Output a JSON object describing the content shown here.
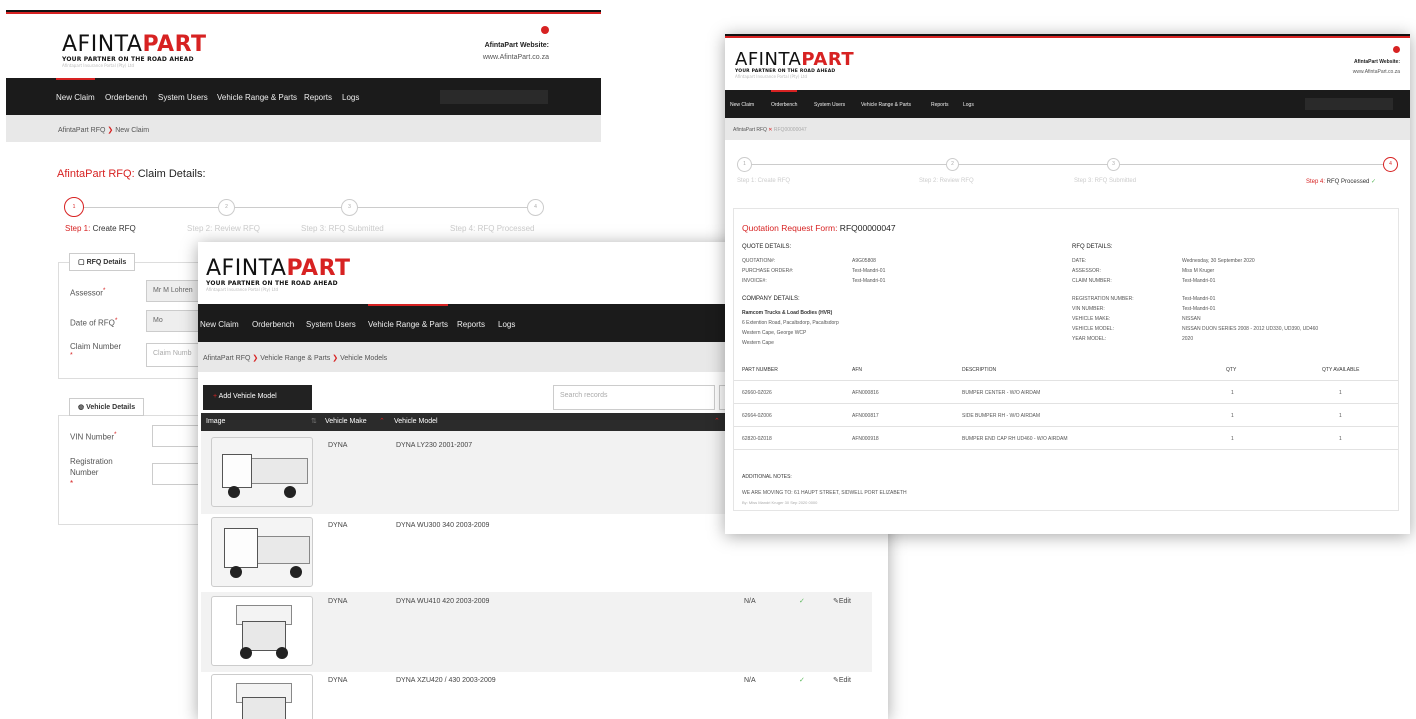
{
  "brand": {
    "part1": "AFINTA",
    "part2": "PART",
    "tagline": "YOUR PARTNER ON THE ROAD AHEAD",
    "sub": "Afintapart Insurance Portal (Pty) Ltd",
    "website_label": "AfintaPart Website:",
    "website_url": "www.AfintaPart.co.za",
    "accent": "#d72222"
  },
  "nav": {
    "items": [
      "New Claim",
      "Orderbench",
      "System Users",
      "Vehicle Range & Parts",
      "Reports",
      "Logs"
    ]
  },
  "back": {
    "breadcrumb_root": "AfintaPart RFQ",
    "breadcrumb_sep": "❯",
    "breadcrumb_current": "New Claim",
    "title_red": "AfintaPart RFQ:",
    "title_rest": " Claim Details:",
    "steps": [
      {
        "num": "1",
        "prefix": "Step 1:",
        "label": " Create RFQ"
      },
      {
        "num": "2",
        "prefix": "Step 2:",
        "label": " Review RFQ"
      },
      {
        "num": "3",
        "prefix": "Step 3:",
        "label": " RFQ Submitted"
      },
      {
        "num": "4",
        "prefix": "Step 4:",
        "label": " RFQ Processed"
      }
    ],
    "rfq_legend": "RFQ Details",
    "assessor_label": "Assessor",
    "assessor_value": "Mr M Lohren",
    "date_label": "Date of RFQ",
    "date_value": "Mo",
    "claim_label": "Claim Number",
    "claim_placeholder": "Claim Numb",
    "vehicle_legend": "Vehicle Details",
    "vin_label": "VIN Number",
    "reg_label1": "Registration",
    "reg_label2": "Number"
  },
  "vehicles": {
    "breadcrumb_root": "AfintaPart RFQ",
    "breadcrumb_mid": "Vehicle Range & Parts",
    "breadcrumb_current": "Vehicle Models",
    "breadcrumb_sep": "❯",
    "add_button": "Add Vehicle Model",
    "search_placeholder": "Search records",
    "columns": [
      "Image",
      "Vehicle Make",
      "Vehicle Model"
    ],
    "rows": [
      {
        "make": "DYNA",
        "model": "DYNA LY230 2001-2007",
        "code": "",
        "status": "",
        "edit": ""
      },
      {
        "make": "DYNA",
        "model": "DYNA WU300 340 2003-2009",
        "code": "",
        "status": "",
        "edit": ""
      },
      {
        "make": "DYNA",
        "model": "DYNA WU410 420 2003-2009",
        "code": "N/A",
        "status": "✓",
        "edit": "Edit"
      },
      {
        "make": "DYNA",
        "model": "DYNA XZU420 / 430 2003-2009",
        "code": "N/A",
        "status": "✓",
        "edit": "Edit"
      }
    ]
  },
  "quote": {
    "breadcrumb_root": "AfintaPart RFQ",
    "breadcrumb_x": "✕",
    "breadcrumb_current": "RFQ00000047",
    "steps": [
      {
        "num": "1",
        "prefix": "Step 1:",
        "label": " Create RFQ"
      },
      {
        "num": "2",
        "prefix": "Step 2:",
        "label": " Review RFQ"
      },
      {
        "num": "3",
        "prefix": "Step 3:",
        "label": " RFQ Submitted"
      },
      {
        "num": "4",
        "prefix": "Step 4:",
        "label": " RFQ Processed",
        "check": "✓"
      }
    ],
    "title_red": "Quotation Request Form:",
    "title_rest": " RFQ00000047",
    "quote_details_h": "QUOTE DETAILS:",
    "quote_details": [
      {
        "k": "QUOTATION#:",
        "v": "A9G05808"
      },
      {
        "k": "PURCHASE ORDER#:",
        "v": "Test-Mandri-01"
      },
      {
        "k": "INVOICE#:",
        "v": "Test-Mandri-01"
      }
    ],
    "rfq_details_h": "RFQ DETAILS:",
    "rfq_details": [
      {
        "k": "DATE:",
        "v": "Wednesday, 30 September 2020"
      },
      {
        "k": "ASSESSOR:",
        "v": "Miss M Kruger"
      },
      {
        "k": "CLAIM NUMBER:",
        "v": "Test-Mandri-01"
      }
    ],
    "company_h": "COMPANY DETAILS:",
    "company_lines": [
      "Ramcom Trucks & Load Bodies (HVR)",
      "6 Extention Road, Pacaltsdorp, Pacaltsdorp",
      "Western Cape, George WCP",
      "Western Cape"
    ],
    "vehicle_details": [
      {
        "k": "REGISTRATION NUMBER:",
        "v": "Test-Mandri-01"
      },
      {
        "k": "VIN NUMBER:",
        "v": "Test-Mandri-01"
      },
      {
        "k": "VEHICLE MAKE:",
        "v": "NISSAN"
      },
      {
        "k": "VEHICLE MODEL:",
        "v": "NISSAN DUON SERIES 2008 - 2012 UD330, UD390, UD460"
      },
      {
        "k": "YEAR MODEL:",
        "v": "2020"
      }
    ],
    "parts_columns": [
      "PART NUMBER",
      "AFN",
      "DESCRIPTION",
      "QTY",
      "QTY AVAILABLE"
    ],
    "parts": [
      {
        "pn": "62660-0Z026",
        "afn": "AFN000816",
        "desc": "BUMPER CENTER - W/O AIRDAM",
        "qty": "1",
        "avail": "1"
      },
      {
        "pn": "62664-0Z006",
        "afn": "AFN000817",
        "desc": "SIDE BUMPER RH - W/O AIRDAM",
        "qty": "1",
        "avail": "1"
      },
      {
        "pn": "62820-0Z018",
        "afn": "AFN000918",
        "desc": "BUMPER END CAP RH UD460 - W/O AIRDAM",
        "qty": "1",
        "avail": "1"
      }
    ],
    "notes_h": "ADDITIONAL NOTES:",
    "notes": "WE ARE MOVING TO: 61 HAUPT STREET, SIDWELL PORT ELIZABETH",
    "notes_by": "By: Miss Mandri Kruger 30 Sep 2020 0000"
  }
}
